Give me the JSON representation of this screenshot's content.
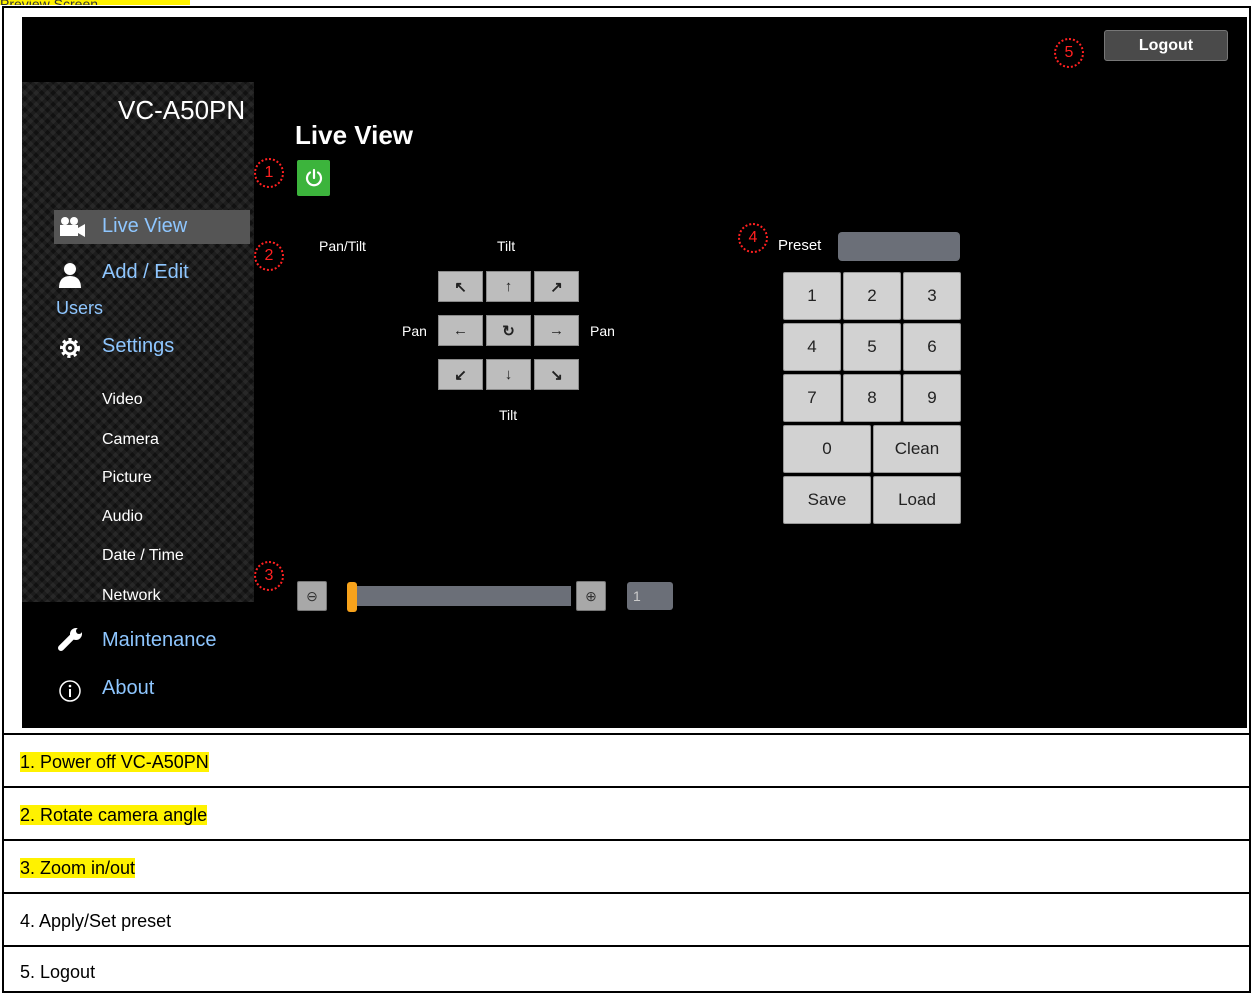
{
  "top_caption": "Preview Screen",
  "app": {
    "model": "VC-A50PN",
    "page_title": "Live View",
    "logout_label": "Logout"
  },
  "nav": {
    "live_view": "Live View",
    "add_edit": "Add / Edit",
    "users": "Users",
    "settings": "Settings",
    "sub": [
      "Video",
      "Camera",
      "Picture",
      "Audio",
      "Date / Time",
      "Network"
    ],
    "maintenance": "Maintenance",
    "about": "About"
  },
  "ptz": {
    "pan_tilt_label": "Pan/Tilt",
    "tilt_top": "Tilt",
    "tilt_bottom": "Tilt",
    "pan_left": "Pan",
    "pan_right": "Pan"
  },
  "zoom": {
    "value": "1",
    "level_fraction": 0.0
  },
  "preset": {
    "label": "Preset",
    "keys": [
      "1",
      "2",
      "3",
      "4",
      "5",
      "6",
      "7",
      "8",
      "9"
    ],
    "zero": "0",
    "clean": "Clean",
    "save": "Save",
    "load": "Load"
  },
  "markers": [
    "1",
    "2",
    "3",
    "4",
    "5"
  ],
  "captions": [
    "1. Power off VC-A50PN",
    "2. Rotate camera angle",
    "3. Zoom in/out",
    "4. Apply/Set preset",
    "5. Logout"
  ],
  "colors": {
    "highlight": "#fff200",
    "power_button": "#3cb43c",
    "nav_text": "#8ec6ff",
    "zoom_thumb": "#f7a21b",
    "marker": "#ff2020"
  }
}
